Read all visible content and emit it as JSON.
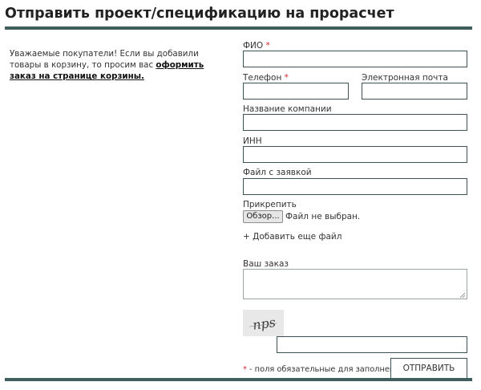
{
  "page": {
    "title": "Отправить проект/спецификацию на прорасчет"
  },
  "intro": {
    "text": "Уважаемые покупатели! Если вы добавили товары в корзину, то просим вас ",
    "link": "оформить заказ на странице корзины."
  },
  "form": {
    "fio_label": "ФИО",
    "phone_label": "Телефон",
    "email_label": "Электронная почта",
    "company_label": "Название компании",
    "inn_label": "ИНН",
    "file_label": "Файл с заявкой",
    "attach_label": "Прикрепить",
    "browse_button": "Обзор...",
    "no_file_text": "Файл не выбран.",
    "add_file_link": "+ Добавить еще файл",
    "order_label": "Ваш заказ",
    "required_mark": "*",
    "footnote": " - поля обязательные для заполнения",
    "submit_button": "ОТПРАВИТЬ",
    "captcha_text": "nps",
    "values": {
      "fio": "",
      "phone": "",
      "email": "",
      "company": "",
      "inn": "",
      "file": "",
      "order": "",
      "captcha": ""
    }
  },
  "colors": {
    "accent_rule": "#3f5f5f",
    "required": "#d6262b",
    "field_border": "#3d5252"
  }
}
